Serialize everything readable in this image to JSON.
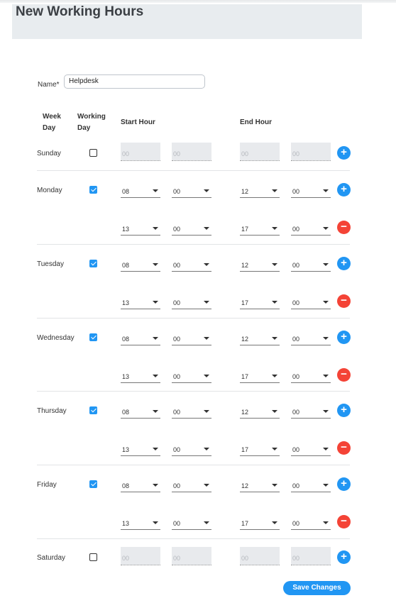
{
  "page_title": "New Working Hours",
  "name": {
    "label": "Name*",
    "value": "Helpdesk"
  },
  "headers": {
    "week_day": [
      "Week",
      "Day"
    ],
    "working_day": [
      "Working",
      "Day"
    ],
    "start_hour": "Start Hour",
    "end_hour": "End Hour"
  },
  "days": [
    {
      "name": "Sunday",
      "working": false,
      "shifts": [
        {
          "start_h": "00",
          "start_m": "00",
          "end_h": "00",
          "end_m": "00"
        }
      ]
    },
    {
      "name": "Monday",
      "working": true,
      "shifts": [
        {
          "start_h": "08",
          "start_m": "00",
          "end_h": "12",
          "end_m": "00"
        },
        {
          "start_h": "13",
          "start_m": "00",
          "end_h": "17",
          "end_m": "00"
        }
      ]
    },
    {
      "name": "Tuesday",
      "working": true,
      "shifts": [
        {
          "start_h": "08",
          "start_m": "00",
          "end_h": "12",
          "end_m": "00"
        },
        {
          "start_h": "13",
          "start_m": "00",
          "end_h": "17",
          "end_m": "00"
        }
      ]
    },
    {
      "name": "Wednesday",
      "working": true,
      "shifts": [
        {
          "start_h": "08",
          "start_m": "00",
          "end_h": "12",
          "end_m": "00"
        },
        {
          "start_h": "13",
          "start_m": "00",
          "end_h": "17",
          "end_m": "00"
        }
      ]
    },
    {
      "name": "Thursday",
      "working": true,
      "shifts": [
        {
          "start_h": "08",
          "start_m": "00",
          "end_h": "12",
          "end_m": "00"
        },
        {
          "start_h": "13",
          "start_m": "00",
          "end_h": "17",
          "end_m": "00"
        }
      ]
    },
    {
      "name": "Friday",
      "working": true,
      "shifts": [
        {
          "start_h": "08",
          "start_m": "00",
          "end_h": "12",
          "end_m": "00"
        },
        {
          "start_h": "13",
          "start_m": "00",
          "end_h": "17",
          "end_m": "00"
        }
      ]
    },
    {
      "name": "Saturday",
      "working": false,
      "shifts": [
        {
          "start_h": "00",
          "start_m": "00",
          "end_h": "00",
          "end_m": "00"
        }
      ]
    }
  ],
  "icons": {
    "add": "plus-icon",
    "remove": "minus-icon"
  },
  "colors": {
    "accent": "#2196f3",
    "danger": "#f44336"
  },
  "save_label": "Save Changes"
}
